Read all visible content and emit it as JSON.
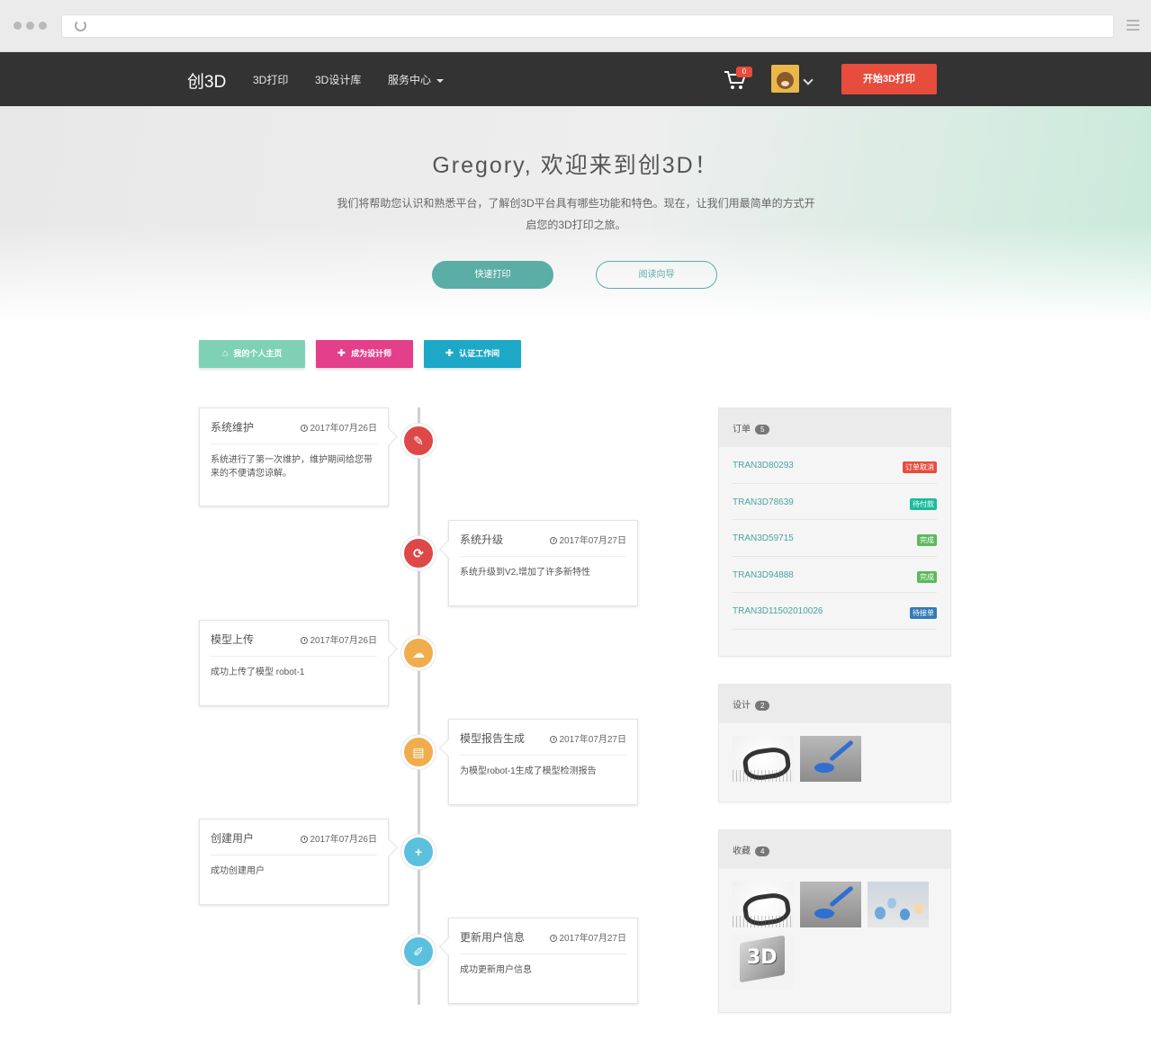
{
  "navbar": {
    "brand": "创3D",
    "items": [
      "3D打印",
      "3D设计库",
      "服务中心"
    ],
    "cart_count": "0",
    "start_label": "开始3D打印"
  },
  "hero": {
    "title": "Gregory, 欢迎来到创3D！",
    "desc_line1": "我们将帮助您认识和熟悉平台，了解创3D平台具有哪些功能和特色。现在，让我们用最简单的方式开",
    "desc_line2": "启您的3D打印之旅。",
    "quick_print": "快速打印",
    "read_guide": "阅读向导"
  },
  "actions": {
    "home": "我的个人主页",
    "designer": "成为设计师",
    "studio": "认证工作间"
  },
  "timeline": [
    {
      "title": "系统维护",
      "date": "2017年07月26日",
      "body": "系统进行了第一次维护，维护期间给您带来的不便请您谅解。",
      "icon": "wrench-icon"
    },
    {
      "title": "系统升级",
      "date": "2017年07月27日",
      "body": "系统升级到V2,增加了许多新特性",
      "icon": "refresh-icon"
    },
    {
      "title": "模型上传",
      "date": "2017年07月26日",
      "body": "成功上传了模型 robot-1",
      "icon": "cloud-upload-icon"
    },
    {
      "title": "模型报告生成",
      "date": "2017年07月27日",
      "body": "为模型robot-1生成了模型检测报告",
      "icon": "report-icon"
    },
    {
      "title": "创建用户",
      "date": "2017年07月26日",
      "body": "成功创建用户",
      "icon": "plus-icon"
    },
    {
      "title": "更新用户信息",
      "date": "2017年07月27日",
      "body": "成功更新用户信息",
      "icon": "edit-icon"
    }
  ],
  "orders": {
    "title": "订单",
    "count": "5",
    "rows": [
      {
        "id": "TRAN3D80293",
        "status": "订单取消",
        "color": "#e74c3c"
      },
      {
        "id": "TRAN3D78639",
        "status": "待付款",
        "color": "#1abc9c"
      },
      {
        "id": "TRAN3D59715",
        "status": "完成",
        "color": "#5cb85c"
      },
      {
        "id": "TRAN3D94888",
        "status": "完成",
        "color": "#5cb85c"
      },
      {
        "id": "TRAN3D11502010026",
        "status": "待接单",
        "color": "#337ab7"
      }
    ]
  },
  "designs": {
    "title": "设计",
    "count": "2"
  },
  "favorites": {
    "title": "收藏",
    "count": "4"
  }
}
